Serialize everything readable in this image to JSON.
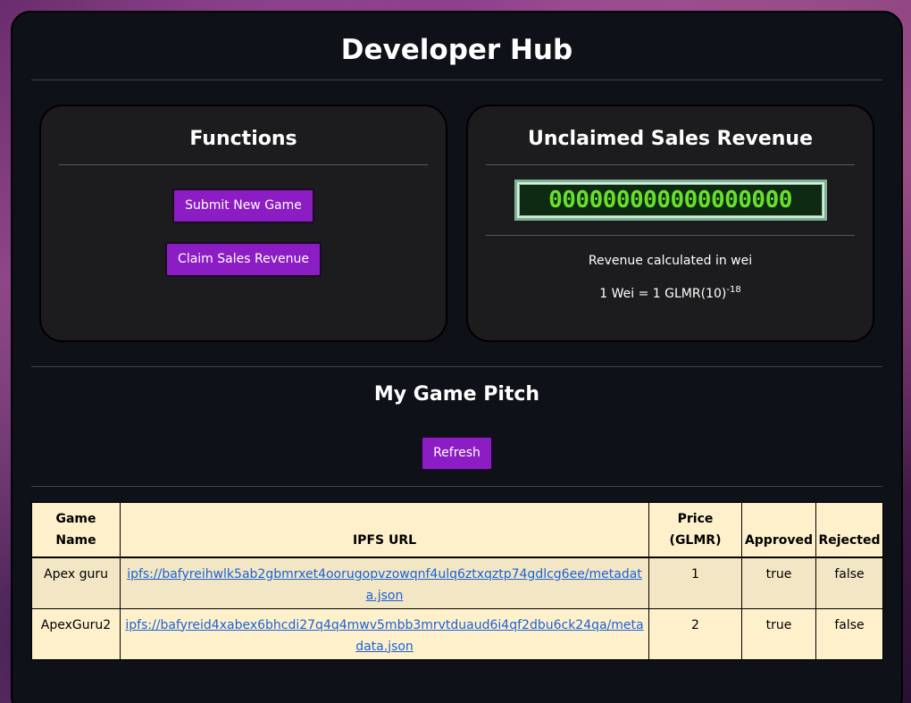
{
  "header": {
    "title": "Developer Hub"
  },
  "functions": {
    "title": "Functions",
    "submit_label": "Submit New Game",
    "claim_label": "Claim Sales Revenue"
  },
  "revenue": {
    "title": "Unclaimed Sales Revenue",
    "counter_value": "000000000000000000",
    "note": "Revenue calculated in wei",
    "conversion_base": "1 Wei = 1 GLMR(10)",
    "conversion_exp": "-18"
  },
  "pitch": {
    "title": "My Game Pitch",
    "refresh_label": "Refresh"
  },
  "table": {
    "headers": [
      "Game Name",
      "IPFS URL",
      "Price (GLMR)",
      "Approved",
      "Rejected"
    ],
    "rows": [
      {
        "name": "Apex guru",
        "url": "ipfs://bafyreihwlk5ab2gbmrxet4oorugopvzowqnf4ulq6ztxqztp74gdlcg6ee/metadata.json",
        "price": "1",
        "approved": "true",
        "rejected": "false"
      },
      {
        "name": "ApexGuru2",
        "url": "ipfs://bafyreid4xabex6bhcdi27q4q4mwv5mbb3mrvtduaud6i4qf2dbu6ck24qa/metadata.json",
        "price": "2",
        "approved": "true",
        "rejected": "false"
      }
    ]
  }
}
